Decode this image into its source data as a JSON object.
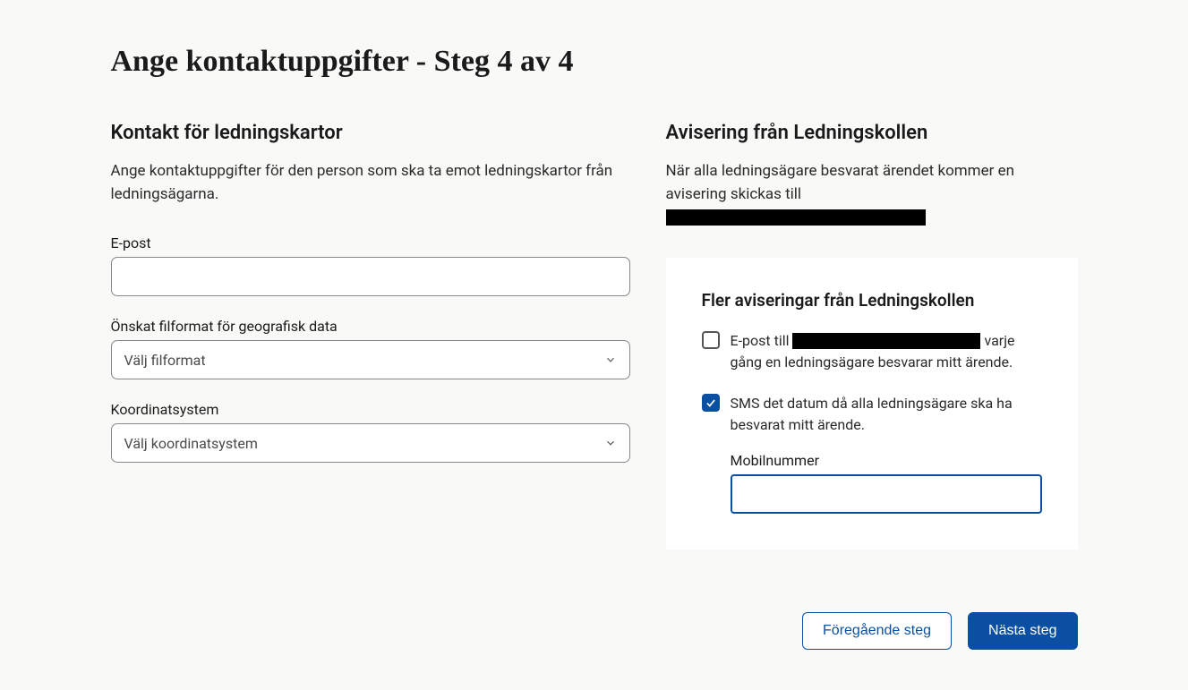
{
  "page": {
    "title": "Ange kontaktuppgifter - Steg 4 av 4"
  },
  "left": {
    "heading": "Kontakt för ledningskartor",
    "intro": "Ange kontaktuppgifter för den person som ska ta emot ledningskartor från ledningsägarna.",
    "email_label": "E-post",
    "email_value": "",
    "fileformat_label": "Önskat filformat för geografisk data",
    "fileformat_placeholder": "Välj filformat",
    "coord_label": "Koordinatsystem",
    "coord_placeholder": "Välj koordinatsystem"
  },
  "right": {
    "heading": "Avisering från Ledningskollen",
    "intro_prefix": "När alla ledningsägare besvarat ärendet kommer en avisering skickas till",
    "card": {
      "heading": "Fler aviseringar från Ledningskollen",
      "email_option_prefix": "E-post till ",
      "email_option_suffix": " varje gång en ledningsägare besvarar mitt ärende.",
      "sms_option": "SMS det datum då alla ledningsägare ska ha besvarat mitt ärende.",
      "mobile_label": "Mobilnummer",
      "mobile_value": ""
    }
  },
  "buttons": {
    "prev": "Föregående steg",
    "next": "Nästa steg"
  }
}
